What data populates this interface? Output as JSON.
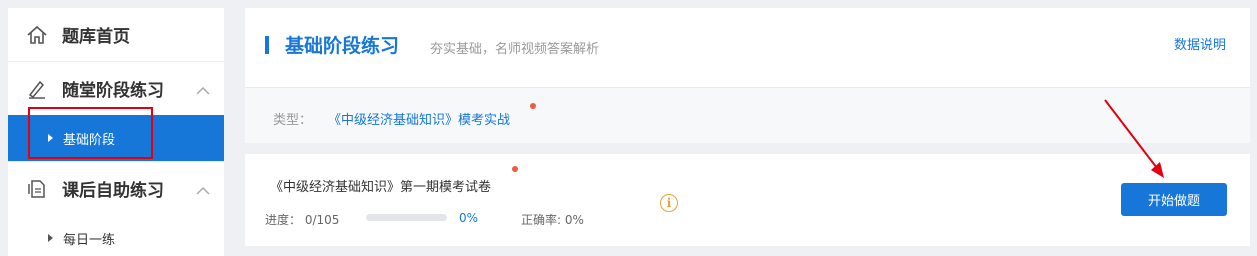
{
  "sidebar": {
    "home_label": "题库首页",
    "group1": {
      "label": "随堂阶段练习",
      "items": [
        {
          "label": "基础阶段"
        }
      ]
    },
    "group2": {
      "label": "课后自助练习",
      "items": [
        {
          "label": "每日一练"
        }
      ]
    }
  },
  "header": {
    "title": "基础阶段练习",
    "subtitle": "夯实基础，名师视频答案解析",
    "help_link": "数据说明"
  },
  "filter": {
    "type_label": "类型：",
    "type_value": "《中级经济基础知识》模考实战"
  },
  "paper": {
    "title": "《中级经济基础知识》第一期模考试卷",
    "progress_text": "进度： 0/105",
    "progress_fraction": 0,
    "progress_percent": "0%",
    "accuracy_text": "正确率: 0%",
    "info_glyph": "i",
    "start_button": "开始做题"
  },
  "colors": {
    "accent": "#1677d9",
    "highlight_box": "#e3000f",
    "annotation_arrow": "#e3000f",
    "new_dot": "#f05a43",
    "info": "#e8a23a"
  }
}
